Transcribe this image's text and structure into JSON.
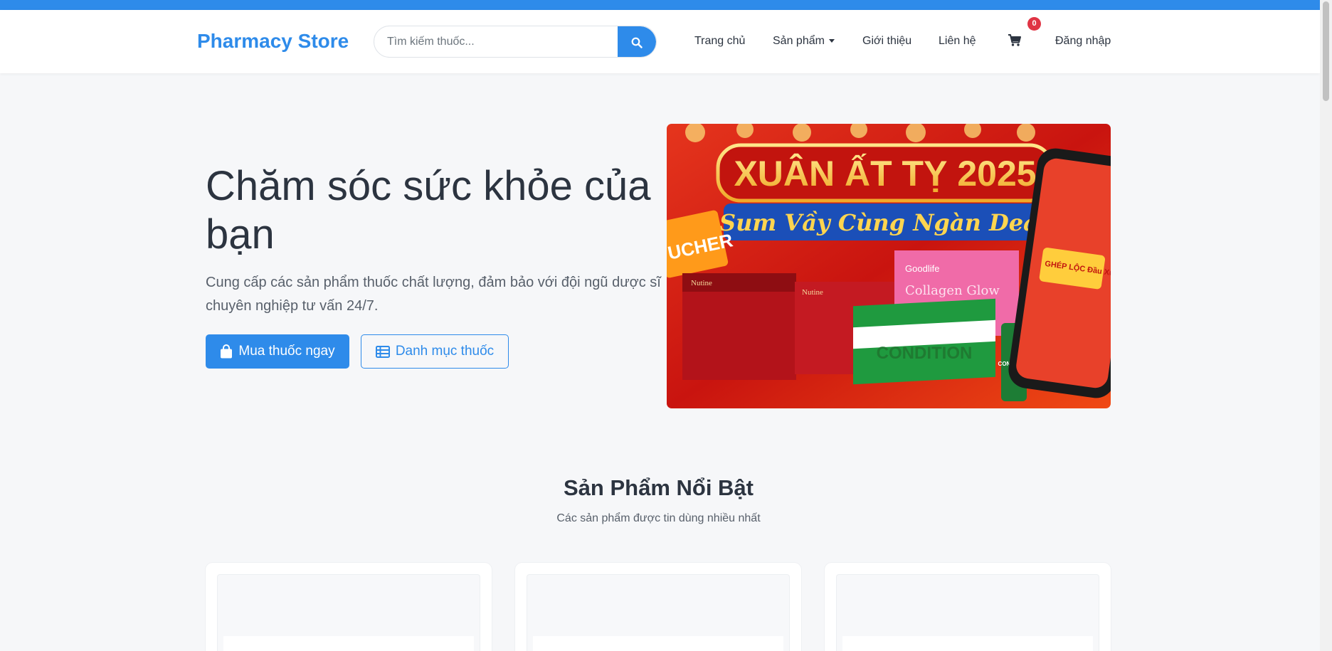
{
  "brand": "Pharmacy Store",
  "search": {
    "placeholder": "Tìm kiếm thuốc..."
  },
  "nav": {
    "home": "Trang chủ",
    "products": "Sản phẩm",
    "about": "Giới thiệu",
    "contact": "Liên hệ",
    "cart_count": "0",
    "login": "Đăng nhập"
  },
  "hero": {
    "title": "Chăm sóc sức khỏe của bạn",
    "description": "Cung cấp các sản phẩm thuốc chất lượng, đảm bảo với đội ngũ dược sĩ chuyên nghiệp tư vấn 24/7.",
    "buy_button": "Mua thuốc ngay",
    "catalog_button": "Danh mục thuốc"
  },
  "banner": {
    "headline": "XUÂN ẤT TỴ 2025",
    "tagline": "Sum Vầy Cùng Ngàn Deal",
    "voucher": "UCHER",
    "product_label": "CONDITION",
    "product_label_2": "CONDITION",
    "brand_goodlife": "Goodlife",
    "collagen": "Collagen Glow",
    "phone_promo": "GHÉP LỘC Đầu Xuân",
    "nutine_1": "Nutine",
    "nutine_2": "Nutine"
  },
  "featured": {
    "title": "Sản Phẩm Nổi Bật",
    "subtitle": "Các sản phẩm được tin dùng nhiều nhất"
  },
  "colors": {
    "primary": "#2e8bea",
    "badge": "#e03444",
    "banner_red": "#d91f1a",
    "banner_gold": "#f5c33b"
  }
}
